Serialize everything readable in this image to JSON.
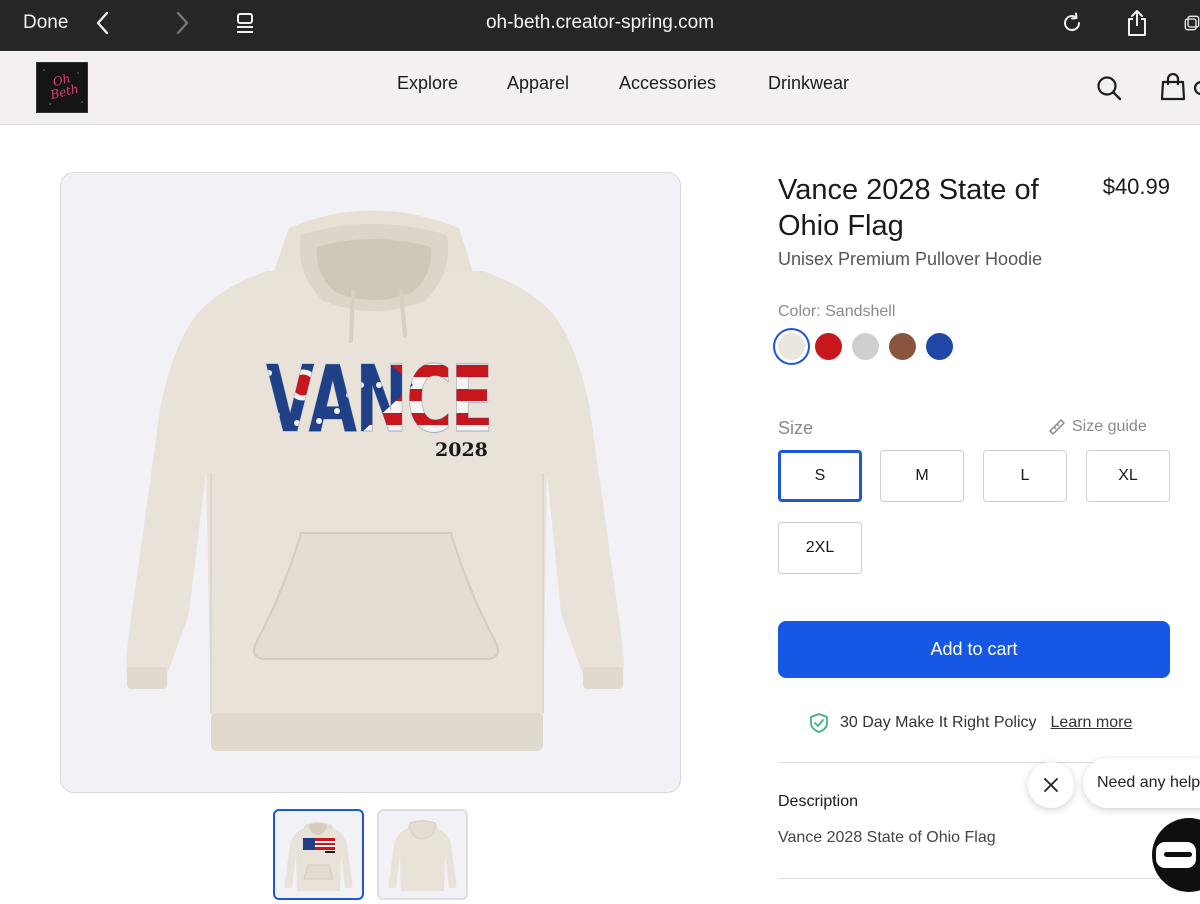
{
  "browser": {
    "done_label": "Done",
    "url": "oh-beth.creator-spring.com",
    "icons": [
      "back-chevron-icon",
      "forward-chevron-icon",
      "reader-menu-icon",
      "reload-icon",
      "share-icon",
      "tabs-icon"
    ]
  },
  "header": {
    "logo_text": "Oh Beth",
    "nav": [
      "Explore",
      "Apparel",
      "Accessories",
      "Drinkwear"
    ],
    "icons": [
      "search-icon",
      "shopping-bag-icon"
    ]
  },
  "product": {
    "title": "Vance 2028 State of Ohio Flag",
    "price": "$40.99",
    "subtitle": "Unisex Premium Pullover Hoodie",
    "design_word": "VANCE",
    "design_year": "2028",
    "color_label": "Color: Sandshell",
    "colors": [
      {
        "name": "Sandshell",
        "hex": "#ebe6de",
        "selected": true
      },
      {
        "name": "Red",
        "hex": "#c8161d",
        "selected": false
      },
      {
        "name": "Grey",
        "hex": "#cfcfd2",
        "selected": false
      },
      {
        "name": "Brown",
        "hex": "#8a5540",
        "selected": false
      },
      {
        "name": "Blue",
        "hex": "#1f47a8",
        "selected": false
      }
    ],
    "size_label": "Size",
    "size_guide_label": "Size guide",
    "sizes": [
      {
        "label": "S",
        "selected": true
      },
      {
        "label": "M",
        "selected": false
      },
      {
        "label": "L",
        "selected": false
      },
      {
        "label": "XL",
        "selected": false
      },
      {
        "label": "2XL",
        "selected": false
      }
    ],
    "add_to_cart_label": "Add to cart",
    "policy_text": "30 Day Make It Right Policy",
    "learn_more_label": "Learn more",
    "description_label": "Description",
    "description_text": "Vance 2028 State of Ohio Flag"
  },
  "chat": {
    "prompt": "Need any help?"
  },
  "colors": {
    "accent": "#1657e6",
    "selected_outline": "#1d56d6",
    "hoodie": "#e8e2d8",
    "flag_red": "#c8161d",
    "flag_blue": "#1f3f86",
    "policy_check": "#3fb27f"
  }
}
